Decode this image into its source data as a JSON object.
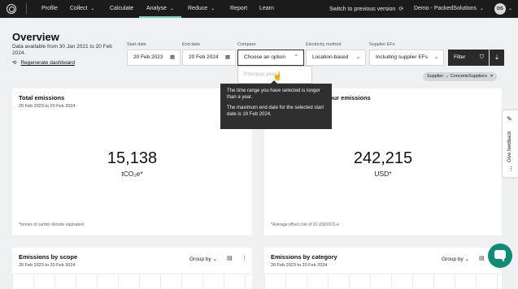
{
  "nav": {
    "items": [
      "Profile",
      "Collect",
      "Calculate",
      "Analyse",
      "Reduce",
      "Report",
      "Learn"
    ],
    "switch_label": "Switch to previous version",
    "demo_label": "Demo - PackedSolutions",
    "avatar": "DS",
    "accent": "#6fd0b6"
  },
  "header": {
    "title": "Overview",
    "availability": "Data available from 30 Jan 2021 to 20 Feb 2024.",
    "regenerate": "Regenerate dashboard"
  },
  "filters": {
    "start_label": "Start date",
    "start_value": "20 Feb 2023",
    "end_label": "End date",
    "end_value": "20 Feb 2024",
    "compare_label": "Compare",
    "compare_value": "Choose an option",
    "method_label": "Electricity method",
    "method_value": "Location-based",
    "efs_label": "Supplier EFs",
    "efs_value": "Including supplier EFs",
    "filter_btn": "Filter",
    "chip": "Supplier → ConcreteSuppliers"
  },
  "dropdown": {
    "placeholder": "Previous year"
  },
  "tooltip": {
    "line1": "The time range you have selected is longer than a year.",
    "line2": "The maximum end date for the selected start date is 19 Feb 2024."
  },
  "cards": {
    "total": {
      "title": "Total emissions",
      "date": "20 Feb 2023 to 20 Feb 2024",
      "value": "15,138",
      "unit": "tCO₂e*",
      "footnote": "*tonnes of carbon dioxide equivalent"
    },
    "offset": {
      "title": "our emissions",
      "value": "242,215",
      "unit": "USD*",
      "footnote": "*Average offset cost of 16 USD/tCO₂e"
    },
    "scope": {
      "title": "Emissions by scope",
      "date": "20 Feb 2023 to 20 Feb 2024",
      "groupby": "Group by"
    },
    "category": {
      "title": "Emissions by category",
      "date": "20 Feb 2023 to 20 Feb 2024",
      "groupby": "Group by"
    }
  },
  "feedback": {
    "label": "Give feedback"
  }
}
